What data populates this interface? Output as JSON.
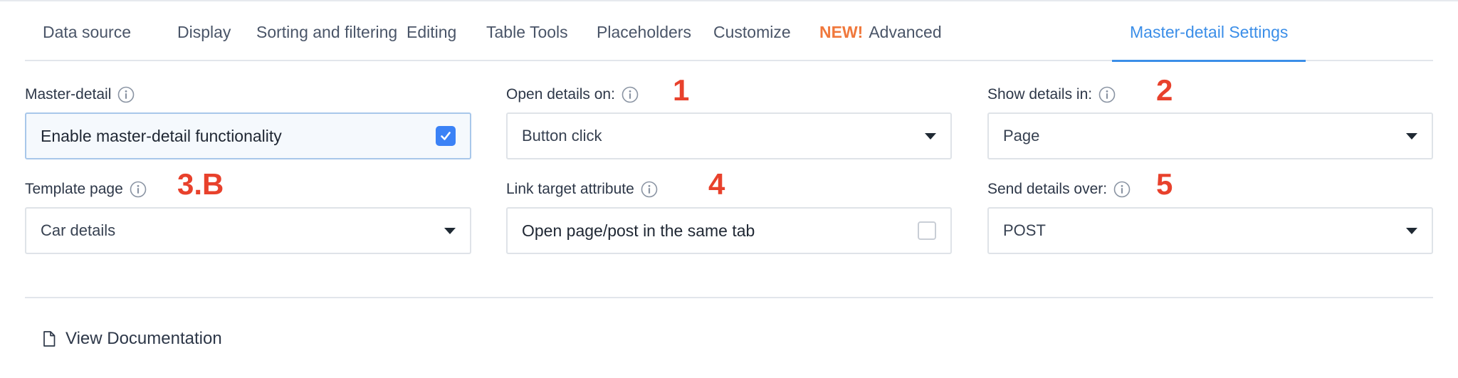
{
  "tabs": [
    {
      "label": "Data source"
    },
    {
      "label": "Display"
    },
    {
      "label": "Sorting and filtering"
    },
    {
      "label": "Editing"
    },
    {
      "label": "Table Tools"
    },
    {
      "label": "Placeholders"
    },
    {
      "label": "Customize"
    },
    {
      "new_badge": "NEW!",
      "label": "Advanced"
    },
    {
      "label": "Master-detail Settings",
      "active": true
    }
  ],
  "fields": {
    "master_detail": {
      "label": "Master-detail",
      "value": "Enable master-detail functionality",
      "checked": true
    },
    "open_details_on": {
      "label": "Open details on:",
      "value": "Button click",
      "annotation": "1"
    },
    "show_details_in": {
      "label": "Show details in:",
      "value": "Page",
      "annotation": "2"
    },
    "template_page": {
      "label": "Template page",
      "value": "Car details",
      "annotation": "3.B"
    },
    "link_target": {
      "label": "Link target attribute",
      "value": "Open page/post in the same tab",
      "checked": false,
      "annotation": "4"
    },
    "send_details_over": {
      "label": "Send details over:",
      "value": "POST",
      "annotation": "5"
    }
  },
  "footer": {
    "documentation_link": "View Documentation"
  },
  "colors": {
    "accent": "#3b8ee8",
    "new_badge": "#f0783c",
    "annotation": "#e8412c",
    "checkbox": "#3b82f6"
  },
  "icons": [
    "info-icon",
    "chevron-down-icon",
    "checkbox-checked-icon",
    "checkbox-empty-icon",
    "document-icon"
  ]
}
